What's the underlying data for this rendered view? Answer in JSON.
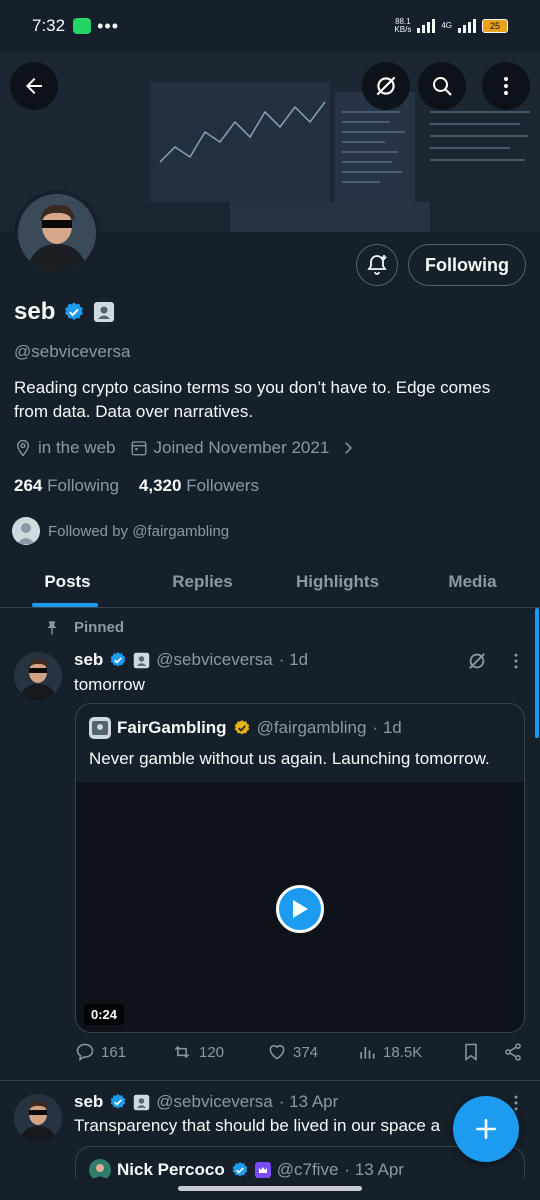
{
  "status_bar": {
    "time": "7:32",
    "dots": "•••",
    "net_speed_value": "88.1",
    "net_speed_unit": "KB/s",
    "network_type": "4G",
    "battery": "25"
  },
  "profile": {
    "display_name": "seb",
    "handle": "@sebviceversa",
    "bio": "Reading crypto casino terms so you don’t have to. Edge comes from data. Data over narratives.",
    "location": "in the web",
    "joined": "Joined November 2021",
    "following_count": "264",
    "following_label": "Following",
    "followers_count": "4,320",
    "followers_label": "Followers",
    "followed_by": "Followed by @fairgambling",
    "follow_button_label": "Following"
  },
  "tabs": [
    {
      "label": "Posts",
      "active": true
    },
    {
      "label": "Replies",
      "active": false
    },
    {
      "label": "Highlights",
      "active": false
    },
    {
      "label": "Media",
      "active": false
    }
  ],
  "posts": [
    {
      "pinned_label": "Pinned",
      "author": "seb",
      "handle": "@sebviceversa",
      "time": "· 1d",
      "text": "tomorrow",
      "quote": {
        "author": "FairGambling",
        "handle": "@fairgambling",
        "time": "· 1d",
        "text": "Never gamble without us again. Launching tomorrow.",
        "video_duration": "0:24"
      },
      "replies": "161",
      "reposts": "120",
      "likes": "374",
      "views": "18.5K"
    },
    {
      "author": "seb",
      "handle": "@sebviceversa",
      "time": "· 13 Apr",
      "text": "Transparency that should be lived in our space a",
      "quote": {
        "author": "Nick Percoco",
        "handle": "@c7five",
        "time": "· 13 Apr"
      }
    }
  ],
  "colors": {
    "background": "#15202b",
    "accent": "#1d9bf0",
    "muted": "#8b98a5",
    "border": "#38444d",
    "verified_gold": "#e8b20e"
  }
}
